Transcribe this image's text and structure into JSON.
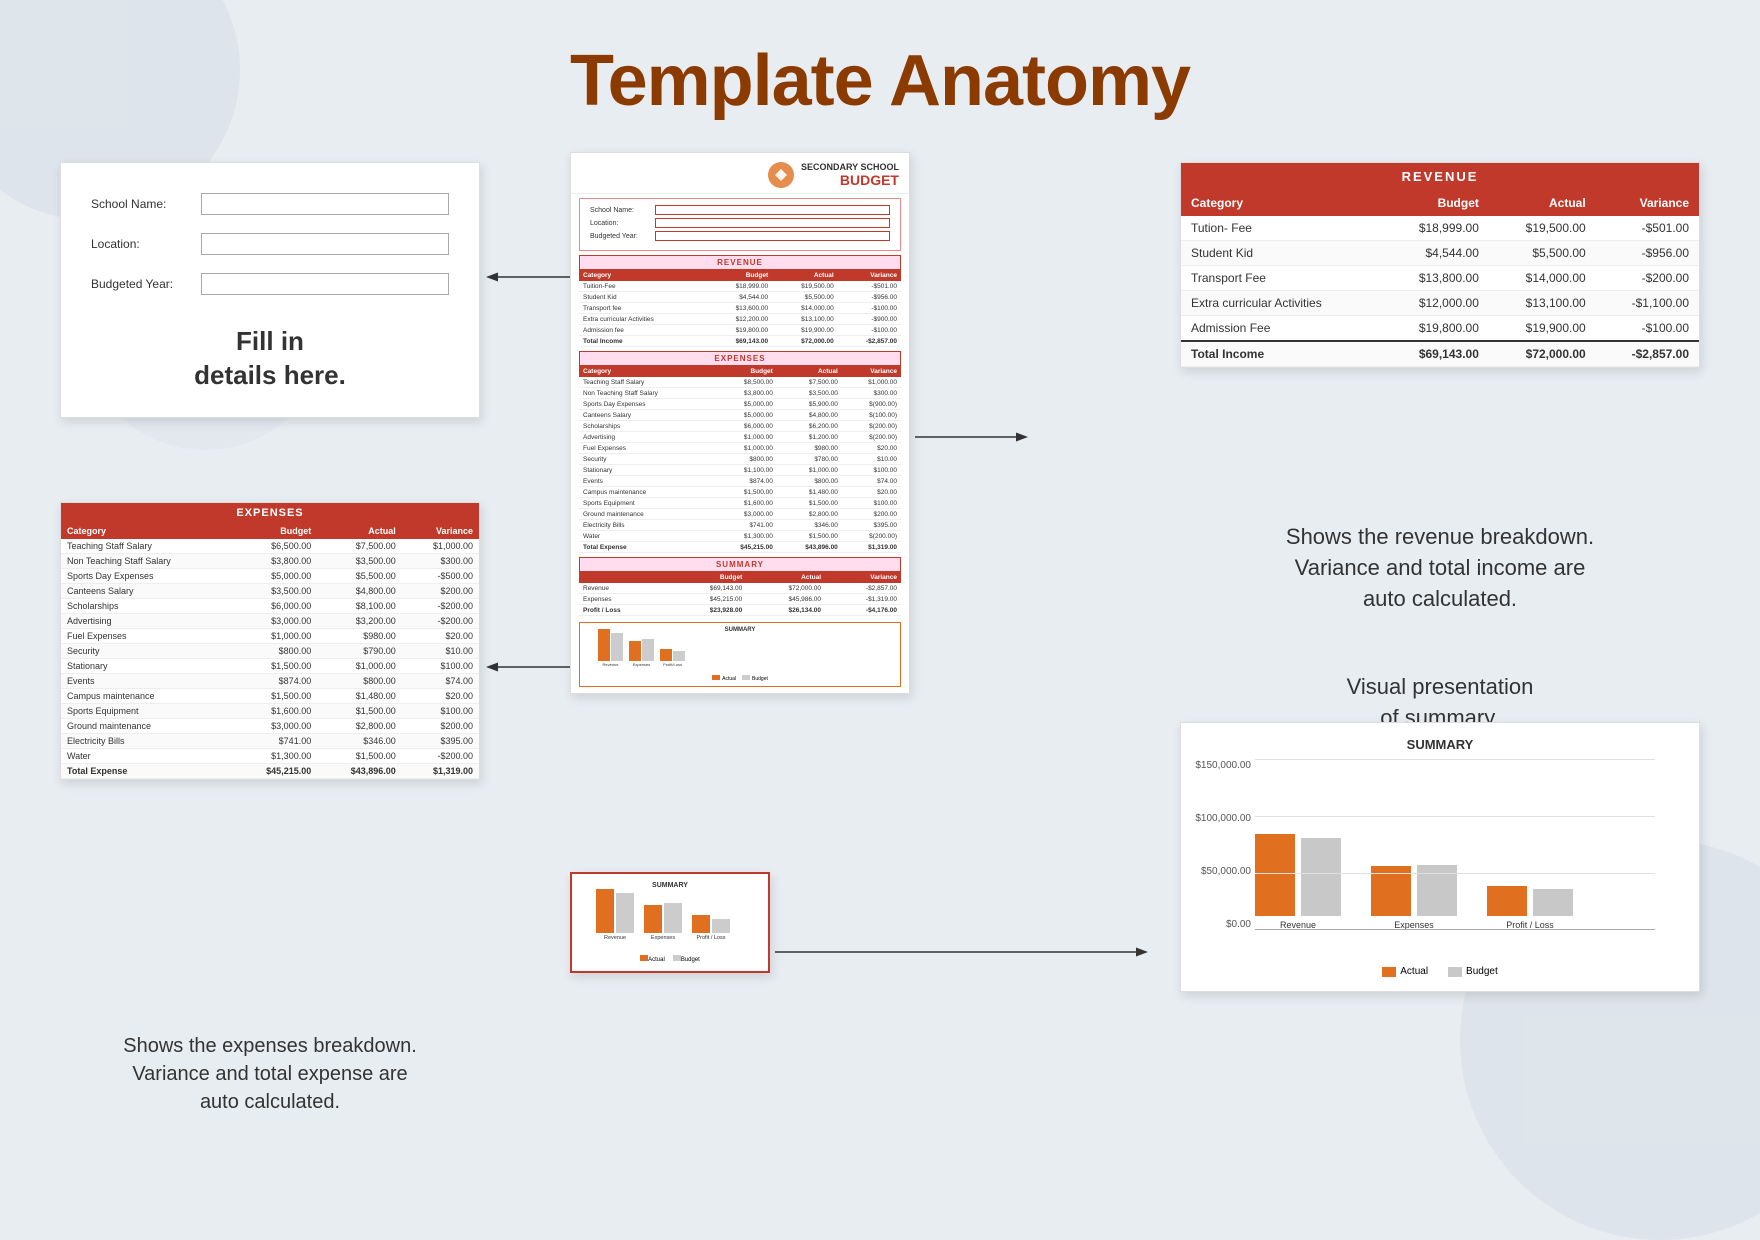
{
  "page": {
    "title": "Template Anatomy",
    "background_color": "#e8edf2"
  },
  "form_card": {
    "fields": [
      {
        "label": "School Name:",
        "value": ""
      },
      {
        "label": "Location:",
        "value": ""
      },
      {
        "label": "Budgeted Year:",
        "value": ""
      }
    ],
    "caption": "Fill in\ndetails here."
  },
  "budget_document": {
    "school_name": "SECONDARY SCHOOL",
    "budget_word": "BUDGET",
    "form_fields": [
      {
        "label": "School Name:"
      },
      {
        "label": "Location:"
      },
      {
        "label": "Budgeted Year:"
      }
    ],
    "revenue_section": {
      "title": "REVENUE",
      "headers": [
        "Category",
        "Budget",
        "Actual",
        "Variance"
      ],
      "rows": [
        [
          "Tuition-Fee",
          "$18,999.00",
          "$19,500.00",
          "-$501.00"
        ],
        [
          "Student Kid",
          "$4,544.00",
          "$5,500.00",
          "-$956.00"
        ],
        [
          "Transport fee",
          "$13,600.00",
          "$14,000.00",
          "-$100.00"
        ],
        [
          "Extra curricular Activities",
          "$12,200.00",
          "$13,100.00",
          "-$900.00"
        ],
        [
          "Admission fee",
          "$19,800.00",
          "$19,900.00",
          "-$100.00"
        ],
        [
          "Total Income",
          "$69,143.00",
          "$72,000.00",
          "-$2,857.00"
        ]
      ]
    },
    "expenses_section": {
      "title": "EXPENSES",
      "headers": [
        "Category",
        "Budget",
        "Actual",
        "Variance"
      ],
      "rows": [
        [
          "Teaching Staff Salary",
          "$8,500.00",
          "$7,500.00",
          "$1,000.00"
        ],
        [
          "Non Teaching Staff Salary",
          "$3,800.00",
          "$3,500.00",
          "$300.00"
        ],
        [
          "Sports Day Expenses",
          "$5,000.00",
          "$5,900.00",
          "$(900.00)"
        ],
        [
          "Canteens Salary",
          "$5,000.00",
          "$4,800.00",
          "$(100.00)"
        ],
        [
          "Scholarships",
          "$6,000.00",
          "$6,200.00",
          "$(200.00)"
        ],
        [
          "Advertising",
          "$1,000.00",
          "$1,200.00",
          "$(200.00)"
        ],
        [
          "Fuel Expenses",
          "$1,000.00",
          "$980.00",
          "$20.00"
        ],
        [
          "Security",
          "$800.00",
          "$780.00",
          "$10.00"
        ],
        [
          "Stationary",
          "$1,100.00",
          "$1,000.00",
          "$100.00"
        ],
        [
          "Events",
          "$874.00",
          "$800.00",
          "$74.00"
        ],
        [
          "Campus maintenance",
          "$1,500.00",
          "$1,480.00",
          "$20.00"
        ],
        [
          "Sports Equipment",
          "$1,600.00",
          "$1,500.00",
          "$100.00"
        ],
        [
          "Ground maintenance",
          "$3,000.00",
          "$2,800.00",
          "$200.00"
        ],
        [
          "Electricity Bills",
          "$741.00",
          "$346.00",
          "$395.00"
        ],
        [
          "Water",
          "$1,300.00",
          "$1,500.00",
          "$(200.00)"
        ],
        [
          "Total Expense",
          "$45,215.00",
          "$43,896.00",
          "$1,319.00"
        ]
      ]
    },
    "summary_section": {
      "title": "SUMMARY",
      "headers": [
        "",
        "Budget",
        "Actual",
        "Variance"
      ],
      "rows": [
        [
          "Revenue",
          "$69,143.00",
          "$72,000.00",
          "-$2,857.00"
        ],
        [
          "Expenses",
          "$45,215.00",
          "$45,986.00",
          "-$1,319.00"
        ],
        [
          "Profit / Loss",
          "$23,928.00",
          "$26,134.00",
          "-$4,176.00"
        ]
      ]
    }
  },
  "revenue_card": {
    "title": "REVENUE",
    "headers": [
      "Category",
      "Budget",
      "Actual",
      "Variance"
    ],
    "rows": [
      [
        "Tution- Fee",
        "$18,999.00",
        "$19,500.00",
        "-$501.00"
      ],
      [
        "Student Kid",
        "$4,544.00",
        "$5,500.00",
        "-$956.00"
      ],
      [
        "Transport Fee",
        "$13,800.00",
        "$14,000.00",
        "-$200.00"
      ],
      [
        "Extra curricular Activities",
        "$12,000.00",
        "$13,100.00",
        "-$1,100.00"
      ],
      [
        "Admission Fee",
        "$19,800.00",
        "$19,900.00",
        "-$100.00"
      ],
      [
        "Total Income",
        "$69,143.00",
        "$72,000.00",
        "-$2,857.00"
      ]
    ],
    "caption": "Shows the revenue breakdown.\nVariance and total income are\nauto calculated."
  },
  "expenses_card": {
    "title": "EXPENSES",
    "headers": [
      "Category",
      "Budget",
      "Actual",
      "Variance"
    ],
    "rows": [
      [
        "Teaching Staff Salary",
        "$6,500.00",
        "$7,500.00",
        "$1,000.00"
      ],
      [
        "Non Teaching Staff Salary",
        "$3,800.00",
        "$3,500.00",
        "$300.00"
      ],
      [
        "Sports Day Expenses",
        "$5,000.00",
        "$5,500.00",
        "-$500.00"
      ],
      [
        "Canteens Salary",
        "$3,500.00",
        "$4,800.00",
        "$200.00"
      ],
      [
        "Scholarships",
        "$6,000.00",
        "$8,100.00",
        "-$200.00"
      ],
      [
        "Advertising",
        "$3,000.00",
        "$3,200.00",
        "-$200.00"
      ],
      [
        "Fuel Expenses",
        "$1,000.00",
        "$980.00",
        "$20.00"
      ],
      [
        "Security",
        "$800.00",
        "$790.00",
        "$10.00"
      ],
      [
        "Stationary",
        "$1,500.00",
        "$1,000.00",
        "$100.00"
      ],
      [
        "Events",
        "$874.00",
        "$800.00",
        "$74.00"
      ],
      [
        "Campus maintenance",
        "$1,500.00",
        "$1,480.00",
        "$20.00"
      ],
      [
        "Sports Equipment",
        "$1,600.00",
        "$1,500.00",
        "$100.00"
      ],
      [
        "Ground maintenance",
        "$3,000.00",
        "$2,800.00",
        "$200.00"
      ],
      [
        "Electricity Bills",
        "$741.00",
        "$346.00",
        "$395.00"
      ],
      [
        "Water",
        "$1,300.00",
        "$1,500.00",
        "-$200.00"
      ],
      [
        "Total Expense",
        "$45,215.00",
        "$43,896.00",
        "$1,319.00"
      ]
    ],
    "caption": "Shows the expenses breakdown.\nVariance and total expense are\nauto calculated."
  },
  "summary_chart": {
    "title": "SUMMARY",
    "bars": [
      {
        "label": "Revenue",
        "actual": 72000,
        "budget": 69143
      },
      {
        "label": "Expenses",
        "actual": 43896,
        "budget": 45215
      },
      {
        "label": "Profit / Loss",
        "actual": 26134,
        "budget": 23928
      }
    ],
    "y_labels": [
      "$0.00",
      "$50,000.00",
      "$100,000.00",
      "$150,000.00"
    ],
    "max_value": 150000,
    "legend": [
      "Actual",
      "Budget"
    ],
    "caption": "Visual presentation\nof summary."
  },
  "arrows": {
    "form_to_budget": "←",
    "budget_to_revenue": "→",
    "budget_to_expenses": "←",
    "mini_chart_to_big": "→"
  }
}
